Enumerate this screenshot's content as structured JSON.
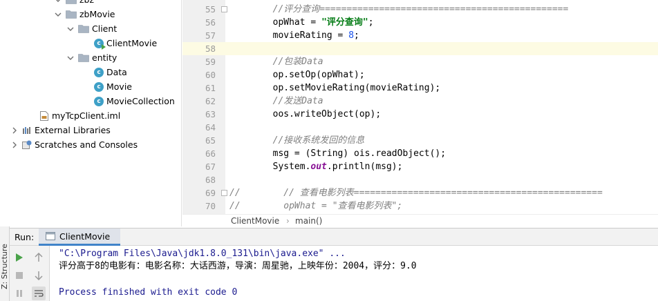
{
  "structure_panel": {
    "label": "Z: Structure"
  },
  "project_tree": {
    "items": [
      {
        "label": "zbz",
        "kind": "folder",
        "expanded": true,
        "depth": 1
      },
      {
        "label": "zbMovie",
        "kind": "folder",
        "expanded": true,
        "depth": 1
      },
      {
        "label": "Client",
        "kind": "folder",
        "expanded": true,
        "depth": 2
      },
      {
        "label": "ClientMovie",
        "kind": "class-run",
        "depth": 3
      },
      {
        "label": "entity",
        "kind": "folder",
        "expanded": true,
        "depth": 2
      },
      {
        "label": "Data",
        "kind": "class",
        "depth": 3
      },
      {
        "label": "Movie",
        "kind": "class",
        "depth": 3
      },
      {
        "label": "MovieCollection",
        "kind": "class",
        "depth": 3
      },
      {
        "label": "myTcpClient.iml",
        "kind": "iml-file",
        "depth": 1
      },
      {
        "label": "External Libraries",
        "kind": "library",
        "expanded": false,
        "depth": 0
      },
      {
        "label": "Scratches and Consoles",
        "kind": "scratches",
        "expanded": false,
        "depth": 0
      }
    ]
  },
  "editor": {
    "current_line": 58,
    "lines": [
      {
        "no": "55",
        "parts": [
          {
            "t": "        //评分查询==============================================",
            "c": "comment"
          }
        ]
      },
      {
        "no": "56",
        "parts": [
          {
            "t": "        opWhat = ",
            "c": "plain"
          },
          {
            "t": "\"评分查询\"",
            "c": "string"
          },
          {
            "t": ";",
            "c": "plain"
          }
        ]
      },
      {
        "no": "57",
        "parts": [
          {
            "t": "        movieRating = ",
            "c": "plain"
          },
          {
            "t": "8",
            "c": "number"
          },
          {
            "t": ";",
            "c": "plain"
          }
        ]
      },
      {
        "no": "58",
        "parts": [
          {
            "t": "",
            "c": "plain"
          }
        ]
      },
      {
        "no": "59",
        "parts": [
          {
            "t": "        //包装Data",
            "c": "comment"
          }
        ]
      },
      {
        "no": "60",
        "parts": [
          {
            "t": "        op.setOp(opWhat);",
            "c": "plain"
          }
        ]
      },
      {
        "no": "61",
        "parts": [
          {
            "t": "        op.setMovieRating(movieRating);",
            "c": "plain"
          }
        ]
      },
      {
        "no": "62",
        "parts": [
          {
            "t": "        //发送Data",
            "c": "comment"
          }
        ]
      },
      {
        "no": "63",
        "parts": [
          {
            "t": "        oos.writeObject(op);",
            "c": "plain"
          }
        ]
      },
      {
        "no": "64",
        "parts": [
          {
            "t": "",
            "c": "plain"
          }
        ]
      },
      {
        "no": "65",
        "parts": [
          {
            "t": "        //接收系统发回的信息",
            "c": "comment"
          }
        ]
      },
      {
        "no": "66",
        "parts": [
          {
            "t": "        msg = (String) ois.readObject();",
            "c": "plain"
          }
        ]
      },
      {
        "no": "67",
        "parts": [
          {
            "t": "        System.",
            "c": "plain"
          },
          {
            "t": "out",
            "c": "field"
          },
          {
            "t": ".println(msg);",
            "c": "plain"
          }
        ]
      },
      {
        "no": "68",
        "parts": [
          {
            "t": "",
            "c": "plain"
          }
        ]
      },
      {
        "no": "69",
        "parts": [
          {
            "t": "//        // 查看电影列表==============================================",
            "c": "comment"
          }
        ]
      },
      {
        "no": "70",
        "parts": [
          {
            "t": "//        opWhat = \"查看电影列表\";",
            "c": "comment"
          }
        ]
      }
    ]
  },
  "breadcrumb": {
    "class_name": "ClientMovie",
    "method_name": "main()"
  },
  "run_panel": {
    "label": "Run:",
    "tab_label": "ClientMovie",
    "console": {
      "command": "\"C:\\Program Files\\Java\\jdk1.8.0_131\\bin\\java.exe\" ...",
      "output": "评分高于8的电影有：电影名称：大话西游，导演：周星驰，上映年份：2004，评分：9.0",
      "exit": "Process finished with exit code 0"
    }
  },
  "colors": {
    "class_icon": "#3ea0c7",
    "folder": "#a9b5c3",
    "run_green": "#4aa34a",
    "tab_underline": "#4083c9",
    "current_line": "#fdfbe3"
  }
}
